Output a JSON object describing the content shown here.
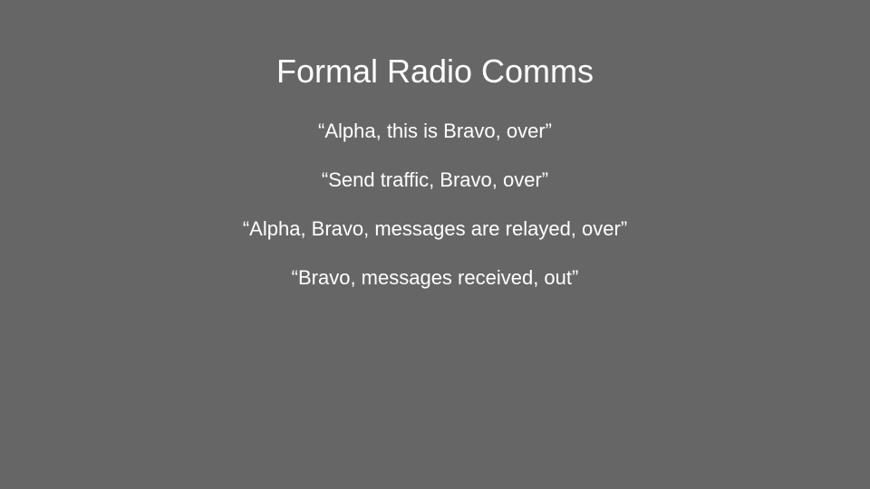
{
  "slide": {
    "title": "Formal Radio Comms",
    "lines": [
      "“Alpha, this is Bravo, over”",
      "“Send traffic, Bravo, over”",
      "“Alpha, Bravo, messages are relayed, over”",
      "“Bravo, messages received, out”"
    ],
    "background_color": "#666666",
    "text_color": "#ffffff"
  }
}
